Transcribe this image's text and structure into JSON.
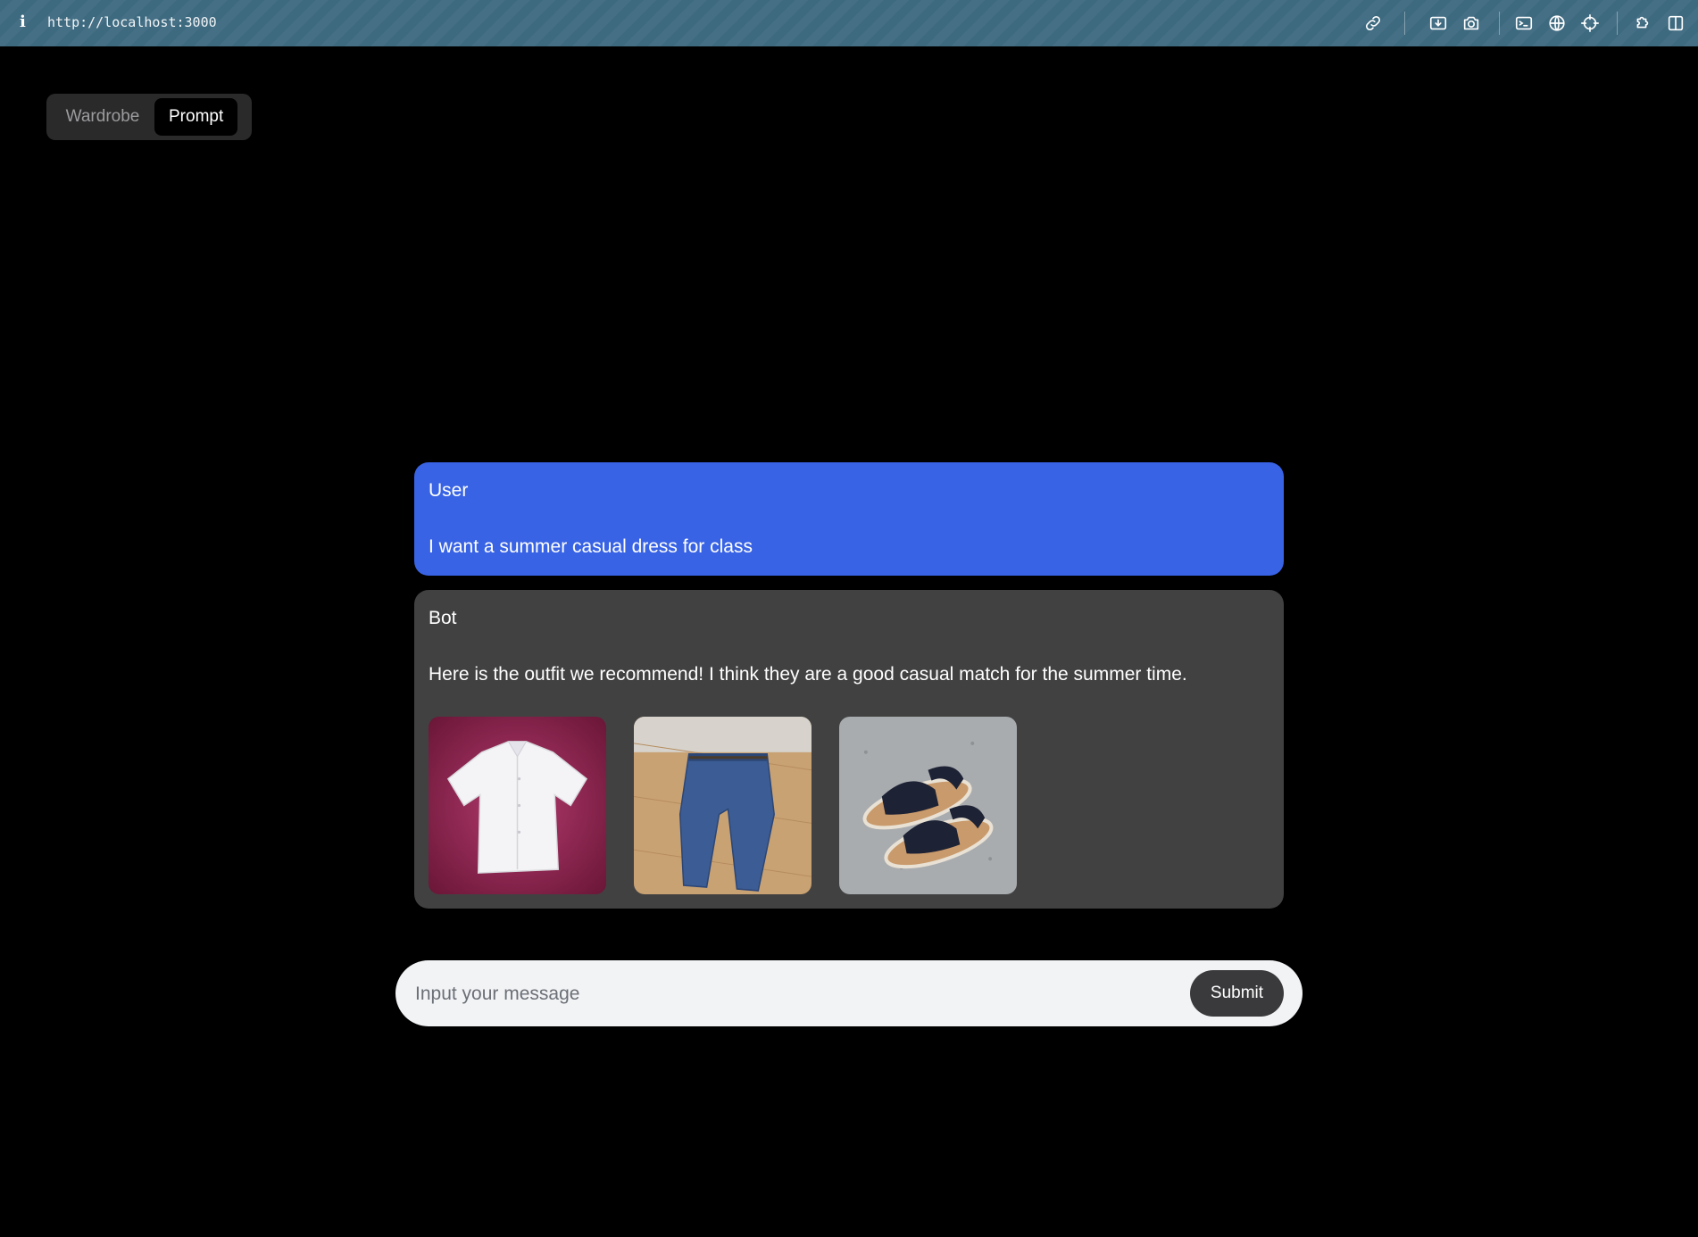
{
  "browser": {
    "info_icon": "i",
    "url": "http://localhost:3000",
    "icons": [
      "link-icon",
      "download-icon",
      "camera-icon",
      "terminal-icon",
      "globe-icon",
      "crosshair-icon",
      "extension-icon",
      "sidebar-icon"
    ]
  },
  "tabs": {
    "wardrobe": "Wardrobe",
    "prompt": "Prompt",
    "active": "Prompt"
  },
  "chat": {
    "user": {
      "role": "User",
      "text": "I want a summer casual dress for class"
    },
    "bot": {
      "role": "Bot",
      "text": "Here is the outfit we recommend! I think they are a good casual match for the summer time.",
      "images": [
        "white-shirt-image",
        "jeans-image",
        "sandals-image"
      ]
    }
  },
  "composer": {
    "placeholder": "Input your message",
    "submit_label": "Submit"
  },
  "colors": {
    "user_bubble": "#3863e4",
    "bot_bubble": "#414141",
    "background": "#000000"
  }
}
